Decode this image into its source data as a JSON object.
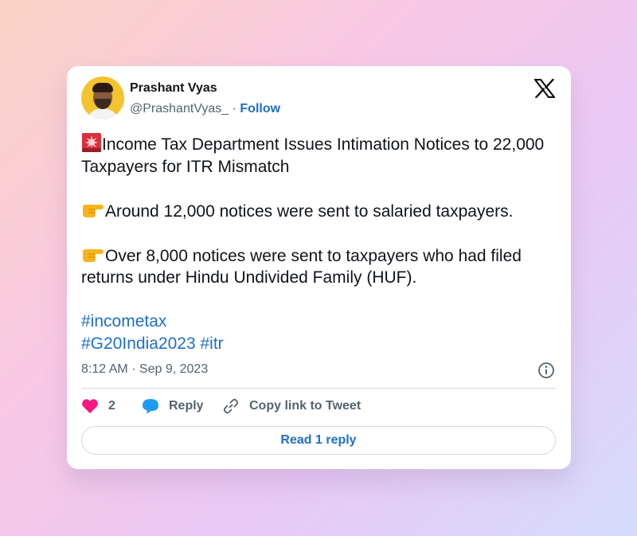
{
  "author": {
    "name": "Prashant Vyas",
    "handle": "@PrashantVyas_",
    "separator": "·",
    "follow_label": "Follow"
  },
  "tweet": {
    "line1": "Income Tax Department Issues Intimation Notices to 22,000 Taxpayers for ITR Mismatch",
    "line2": "Around 12,000 notices were sent to salaried taxpayers.",
    "line3": "Over 8,000 notices were sent to taxpayers who had filed returns under Hindu Undivided Family (HUF).",
    "hashtags": [
      "#incometax",
      "#G20India2023",
      "#itr"
    ]
  },
  "timestamp": "8:12 AM · Sep 9, 2023",
  "actions": {
    "like_count": "2",
    "reply_label": "Reply",
    "copy_label": "Copy link to Tweet"
  },
  "read_reply_label": "Read 1 reply",
  "icons": {
    "brand": "x-logo-icon",
    "alert": "siren-emoji-icon",
    "pointer": "pointing-hand-emoji-icon",
    "info": "info-icon",
    "like": "heart-icon",
    "reply": "speech-bubble-icon",
    "copy": "link-icon"
  },
  "colors": {
    "link_blue": "#1d6fc7",
    "heart_pink": "#f91880",
    "reply_blue": "#1d9bf0",
    "text_dark": "#0f1419",
    "text_muted": "#536471"
  }
}
